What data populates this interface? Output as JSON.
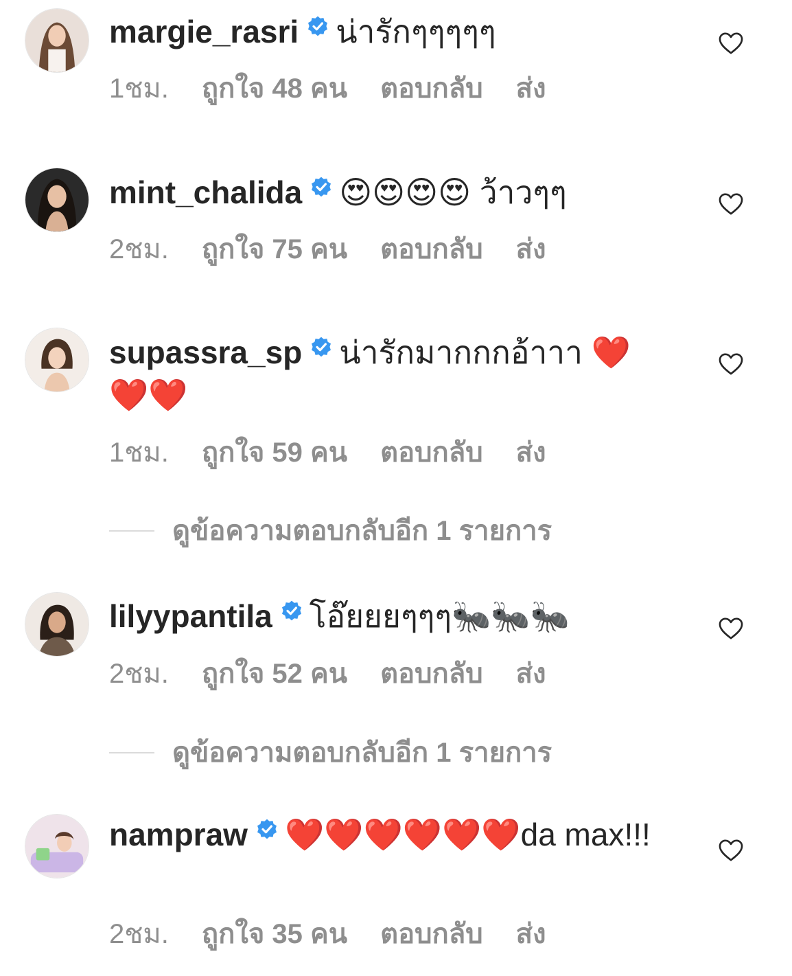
{
  "colors": {
    "text": "#262626",
    "muted": "#8e8e8e",
    "verified": "#3897f0",
    "divider": "#dbdbdb"
  },
  "comments": [
    {
      "username": "margie_rasri",
      "text": "น่ารักๆๆๆๆๆ",
      "time": "1ชม.",
      "likes": "ถูกใจ 48 คน",
      "reply": "ตอบกลับ",
      "send": "ส่ง",
      "verified_icon": "verified-badge-icon",
      "like_icon": "heart-outline-icon"
    },
    {
      "username": "mint_chalida",
      "text": "😍😍😍😍 ว้าวๆๆ",
      "time": "2ชม.",
      "likes": "ถูกใจ 75 คน",
      "reply": "ตอบกลับ",
      "send": "ส่ง",
      "verified_icon": "verified-badge-icon",
      "like_icon": "heart-outline-icon"
    },
    {
      "username": "supassra_sp",
      "text": "น่ารักมากกกอ้าาา ❤️❤️❤️",
      "time": "1ชม.",
      "likes": "ถูกใจ 59 คน",
      "reply": "ตอบกลับ",
      "send": "ส่ง",
      "view_replies": "ดูข้อความตอบกลับอีก 1 รายการ",
      "verified_icon": "verified-badge-icon",
      "like_icon": "heart-outline-icon"
    },
    {
      "username": "lilyypantila",
      "text": "โอ๊ยยยๆๆๆ🐜🐜🐜",
      "time": "2ชม.",
      "likes": "ถูกใจ 52 คน",
      "reply": "ตอบกลับ",
      "send": "ส่ง",
      "view_replies": "ดูข้อความตอบกลับอีก 1 รายการ",
      "verified_icon": "verified-badge-icon",
      "like_icon": "heart-outline-icon"
    },
    {
      "username": "nampraw",
      "text": "❤️❤️❤️❤️❤️❤️da max!!!",
      "time": "2ชม.",
      "likes": "ถูกใจ 35 คน",
      "reply": "ตอบกลับ",
      "send": "ส่ง",
      "verified_icon": "verified-badge-icon",
      "like_icon": "heart-outline-icon"
    }
  ]
}
